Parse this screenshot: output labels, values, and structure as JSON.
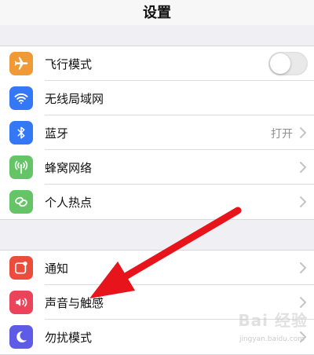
{
  "nav": {
    "title": "设置"
  },
  "colors": {
    "airplane": "#f09a37",
    "wifi": "#3478f6",
    "bluetooth": "#3478f6",
    "cellular": "#65c466",
    "hotspot": "#65c466",
    "notifications": "#eb4d3d",
    "sounds": "#eb445a",
    "dnd": "#5e5ce6",
    "arrow": "#e8141c"
  },
  "group1": {
    "airplane": {
      "label": "飞行模式",
      "icon": "airplane-icon"
    },
    "wifi": {
      "label": "无线局域网",
      "icon": "wifi-icon"
    },
    "bluetooth": {
      "label": "蓝牙",
      "value": "打开",
      "icon": "bluetooth-icon"
    },
    "cellular": {
      "label": "蜂窝网络",
      "icon": "antenna-icon"
    },
    "hotspot": {
      "label": "个人热点",
      "icon": "link-icon"
    }
  },
  "group2": {
    "notifications": {
      "label": "通知",
      "icon": "notification-icon"
    },
    "sounds": {
      "label": "声音与触感",
      "icon": "speaker-icon"
    },
    "dnd": {
      "label": "勿扰模式",
      "icon": "moon-icon"
    }
  },
  "watermark": {
    "text": "Bai 经验",
    "url": "jingyan.baidu.com"
  }
}
